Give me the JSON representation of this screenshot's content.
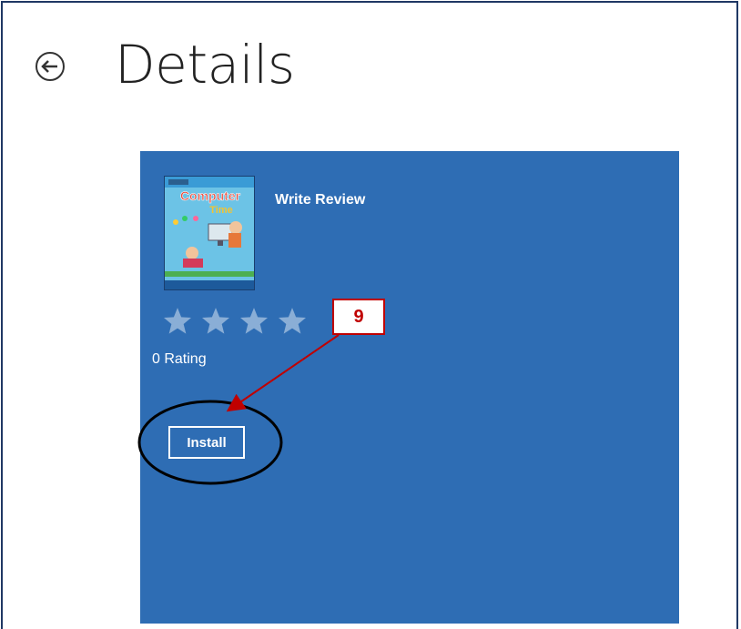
{
  "header": {
    "title": "Details",
    "back_icon": "arrow-left-circle-icon"
  },
  "app": {
    "cover_title_top": "Computer",
    "cover_title_bottom": "Time",
    "write_review_label": "Write Review",
    "rating": 0,
    "rating_label": "0 Rating",
    "install_label": "Install",
    "panel_color": "#2e6db4"
  },
  "annotation": {
    "callout_number": "9",
    "callout_color": "#c00000"
  }
}
